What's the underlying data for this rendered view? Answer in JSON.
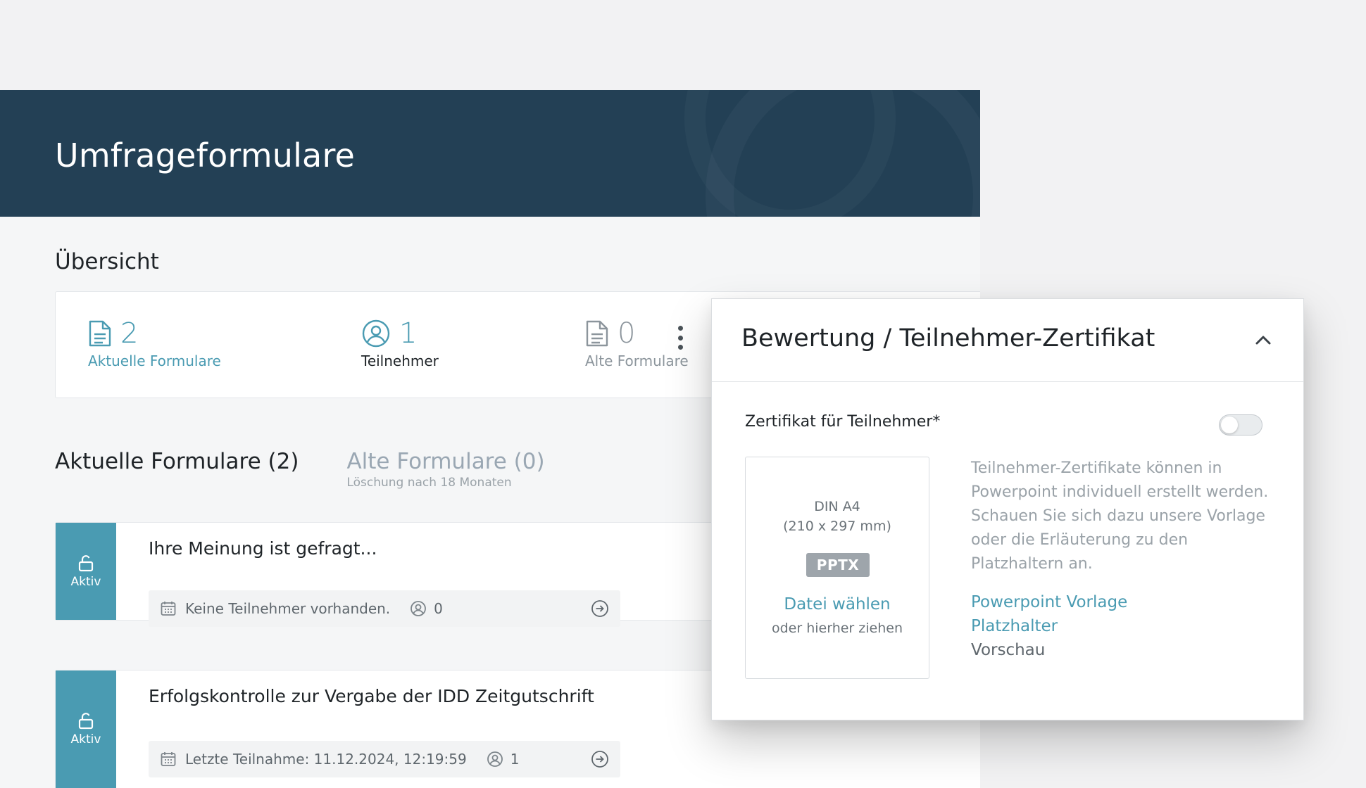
{
  "header": {
    "title": "Umfrageformulare"
  },
  "overview": {
    "title": "Übersicht",
    "stats": [
      {
        "value": "2",
        "label": "Aktuelle Formulare",
        "icon": "document-icon"
      },
      {
        "value": "1",
        "label": "Teilnehmer",
        "icon": "user-circle-icon"
      },
      {
        "value": "0",
        "label": "Alte Formulare",
        "icon": "document-icon"
      }
    ]
  },
  "tabs": {
    "current": "Aktuelle Formulare (2)",
    "old": "Alte Formulare (0)",
    "old_sub": "Löschung nach 18 Monaten"
  },
  "forms": [
    {
      "status": "Aktiv",
      "title": "Ihre Meinung ist gefragt...",
      "meta": "Keine Teilnehmer vorhanden.",
      "participants": "0"
    },
    {
      "status": "Aktiv",
      "title": "Erfolgskontrolle zur Vergabe der IDD Zeitgutschrift",
      "meta": "Letzte Teilnahme: 11.12.2024, 12:19:59",
      "participants": "1"
    }
  ],
  "panel": {
    "title": "Bewertung / Teilnehmer-Zertifikat",
    "cert_label": "Zertifikat für Teilnehmer*",
    "toggle_on": false,
    "upload": {
      "format": "DIN A4",
      "size": "(210 x 297 mm)",
      "badge": "PPTX",
      "choose": "Datei wählen",
      "drag": "oder hierher ziehen"
    },
    "help": "Teilnehmer-Zertifikate können in Powerpoint individuell erstellt werden. Schauen Sie sich dazu unsere Vorlage oder die Erläuterung zu den Platzhaltern an.",
    "links": {
      "template": "Powerpoint Vorlage",
      "placeholder": "Platzhalter",
      "preview": "Vorschau"
    }
  },
  "colors": {
    "banner": "#234055",
    "accent": "#4a9bb2",
    "badge": "#9ea5ab"
  }
}
